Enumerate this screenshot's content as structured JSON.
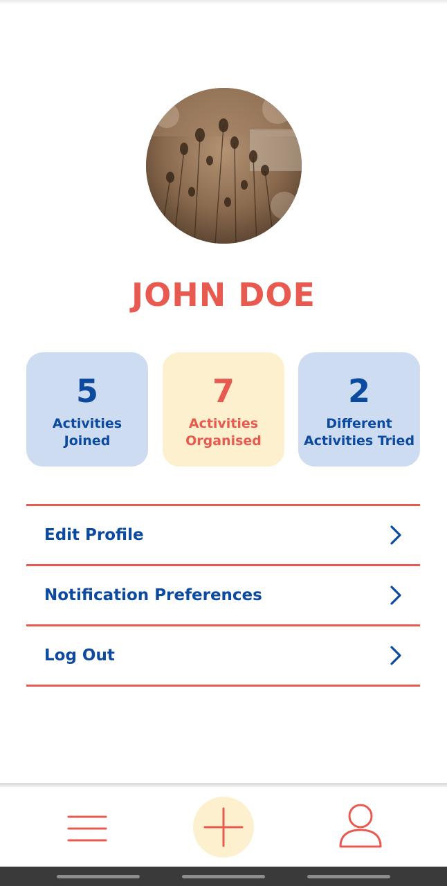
{
  "profile": {
    "name": "JOHN DOE",
    "avatar_icon": "profile-photo"
  },
  "stats": [
    {
      "value": "5",
      "label": "Activities\nJoined",
      "color": "#cddcf0"
    },
    {
      "value": "7",
      "label": "Activities\nOrganised",
      "color": "#fcf0cf"
    },
    {
      "value": "2",
      "label": "Different\nActivities Tried",
      "color": "#cddcf0"
    }
  ],
  "menu": [
    {
      "label": "Edit Profile",
      "icon": "chevron-right-icon"
    },
    {
      "label": "Notification Preferences",
      "icon": "chevron-right-icon"
    },
    {
      "label": "Log Out",
      "icon": "chevron-right-icon"
    }
  ],
  "bottom_nav": {
    "items": [
      "hamburger-menu-icon",
      "plus-icon",
      "user-icon"
    ]
  },
  "colors": {
    "accent": "#e85a4f",
    "primary": "#0c4aa0",
    "card_blue": "#cddcf0",
    "card_yellow": "#fcf0cf"
  }
}
